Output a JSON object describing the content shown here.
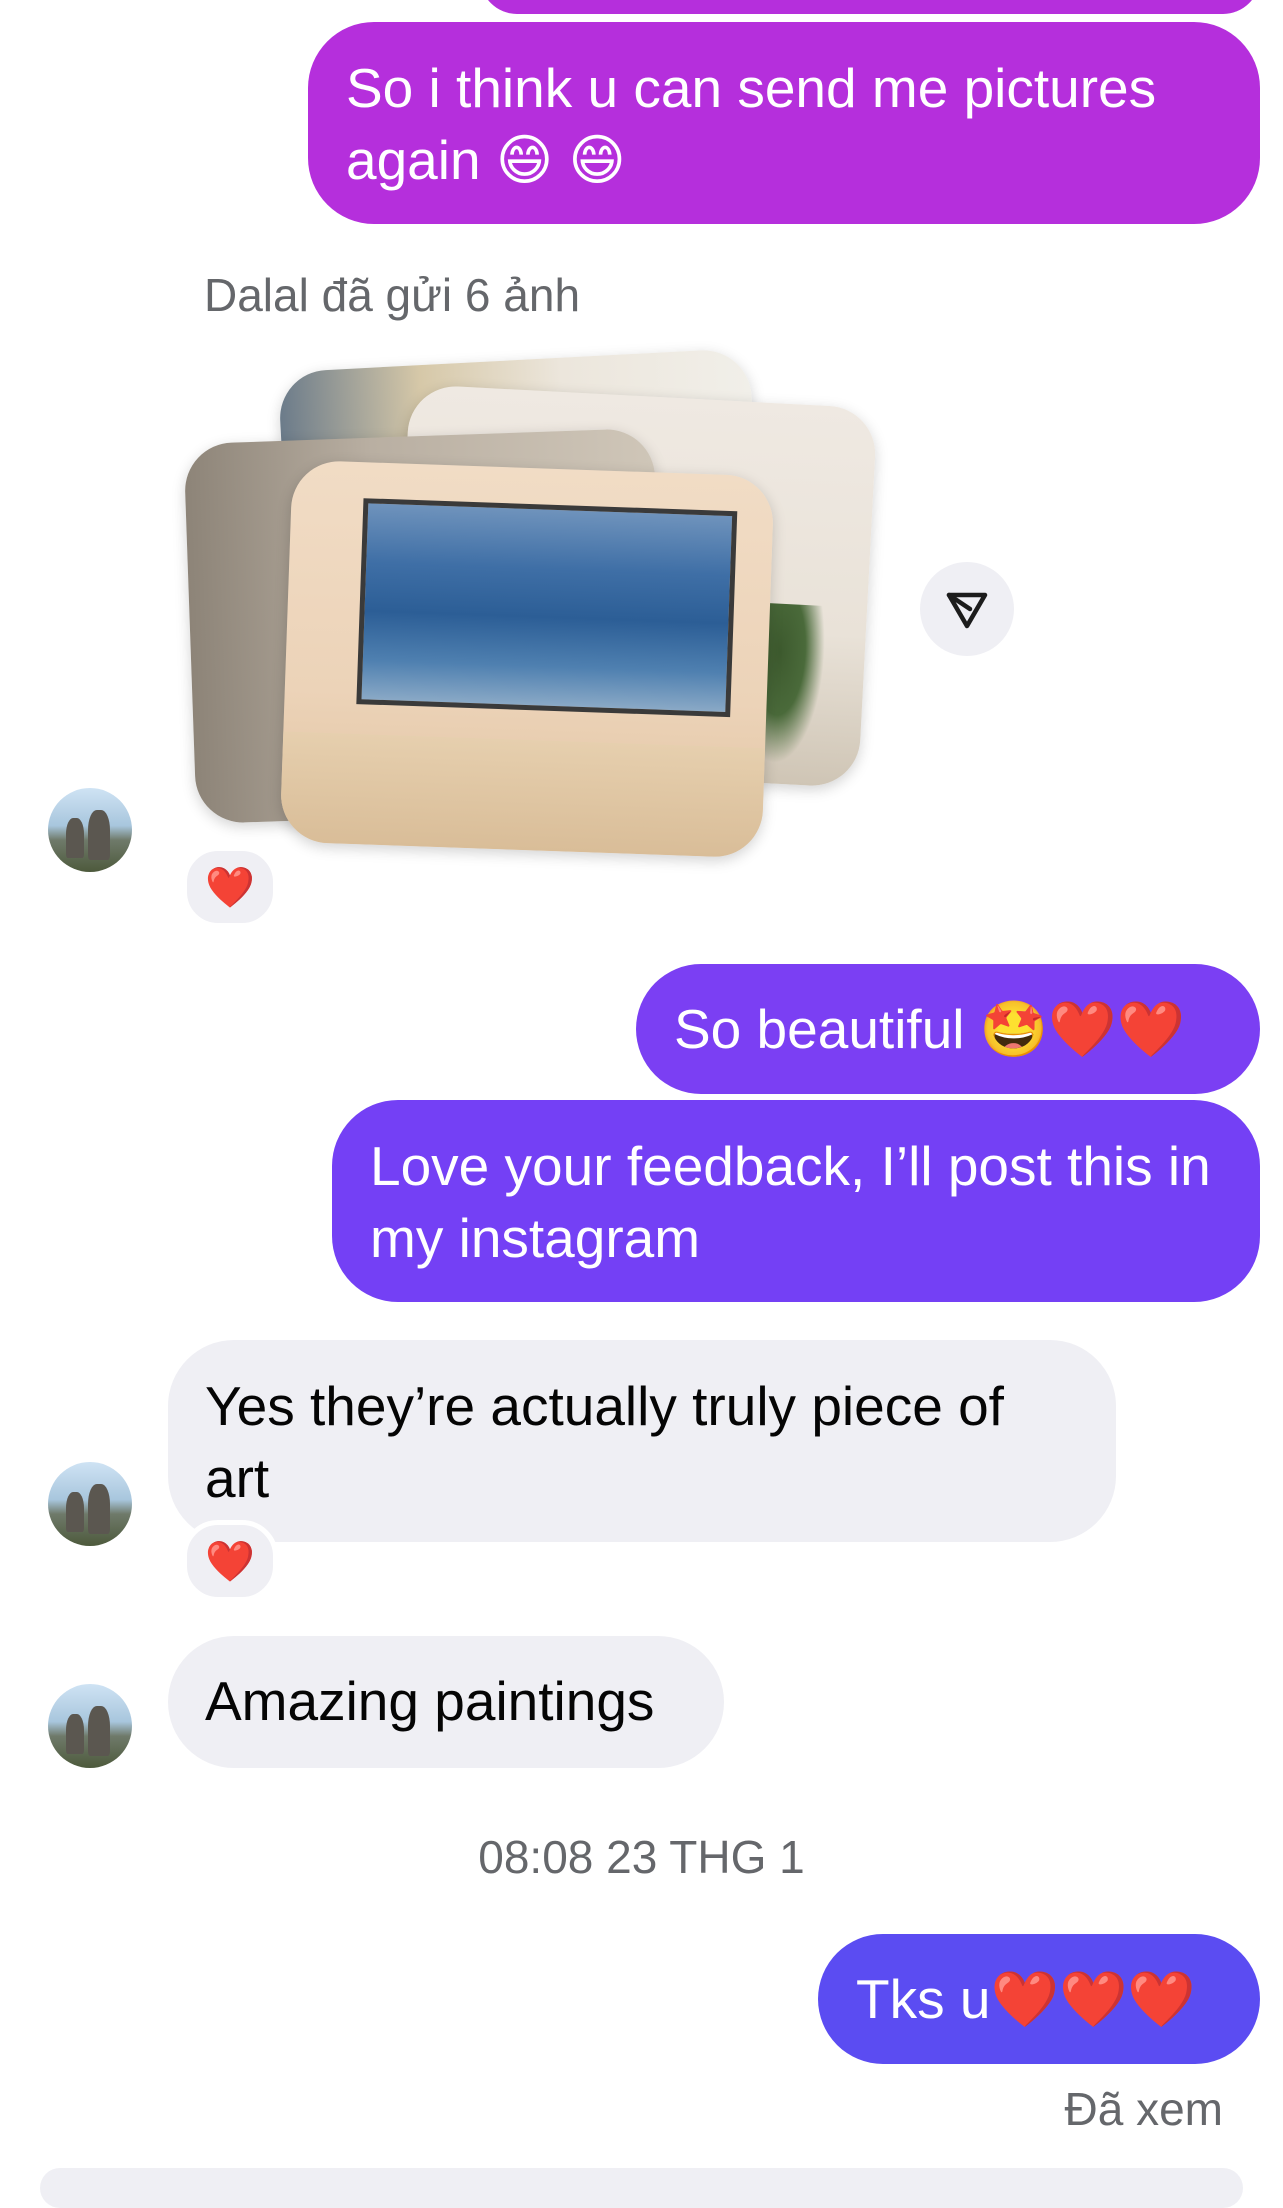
{
  "messages": {
    "m1": {
      "text": "So i think u can send me pictures again",
      "emojis": "😄 😄"
    },
    "photo_notice": "Dalal đã gửi 6 ảnh",
    "photo_reaction": "❤️",
    "m2": {
      "text": "So beautiful",
      "emojis": "🤩❤️❤️"
    },
    "m3": {
      "text": "Love your feedback, I’ll post this in my instagram"
    },
    "m4": {
      "text": "Yes they’re actually truly piece of art",
      "reaction": "❤️"
    },
    "m5": {
      "text": "Amazing paintings"
    },
    "timestamp": "08:08 23 THG 1",
    "m6": {
      "text": "Tks u",
      "emojis": "❤️❤️❤️"
    },
    "status": "Đã xem"
  },
  "colors": {
    "outgoing_pink": "#b52fdc",
    "outgoing_violet": "#7440f5",
    "outgoing_indigo": "#5b4cf2",
    "incoming_bg": "#efeff4",
    "meta_text": "#65676b"
  },
  "icons": {
    "share": "share-icon",
    "avatar": "avatar"
  }
}
